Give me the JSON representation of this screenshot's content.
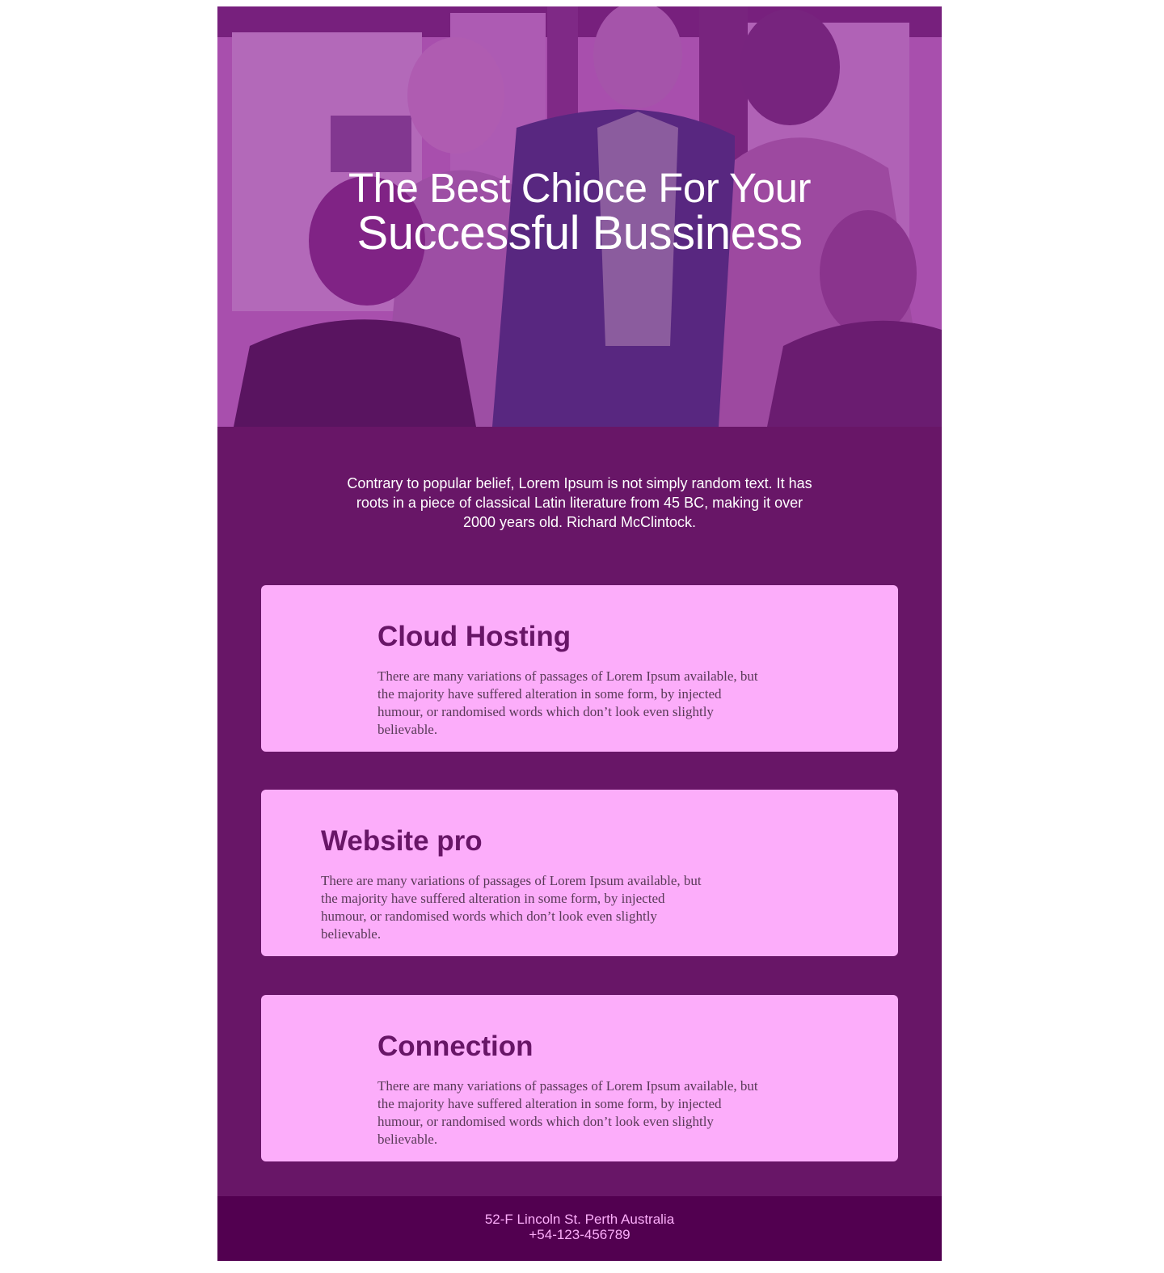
{
  "hero": {
    "title_line1": "The Best Chioce For Your",
    "title_line2": "Successful Bussiness"
  },
  "intro": {
    "text": "Contrary to popular belief, Lorem Ipsum is not simply random text. It has roots in a piece of classical Latin literature from 45 BC, making it over 2000 years old. Richard McClintock."
  },
  "cards": [
    {
      "title": "Cloud Hosting",
      "text": "There are many variations of passages of Lorem Ipsum available, but the majority have suffered alteration in some form, by injected humour, or randomised words which don’t look even slightly believable."
    },
    {
      "title": "Website pro",
      "text": "There are many variations of passages of Lorem Ipsum available, but the majority have suffered alteration in some form, by injected humour, or randomised words which don’t look even slightly believable."
    },
    {
      "title": "Connection",
      "text": "There are many variations of passages of Lorem Ipsum available, but the majority have suffered alteration in some form, by injected humour, or randomised words which don’t look even slightly believable."
    }
  ],
  "footer": {
    "address": "52-F Lincoln St. Perth Australia",
    "phone": "+54-123-456789"
  },
  "colors": {
    "body_bg": "#681667",
    "card_bg": "#fcadfa",
    "card_title": "#681667",
    "footer_bg": "#520050",
    "footer_text": "#fcadfa",
    "hero_overlay": "#b463b9"
  }
}
